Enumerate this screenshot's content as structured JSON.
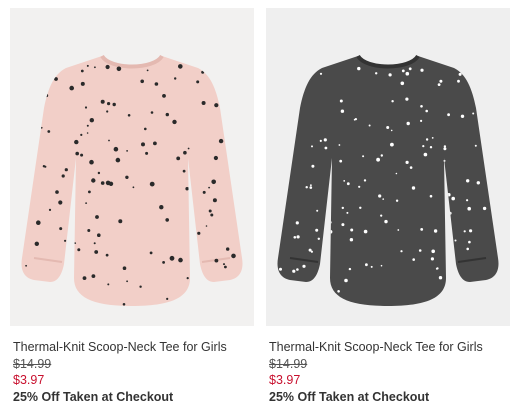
{
  "products": [
    {
      "title": "Thermal-Knit Scoop-Neck Tee for Girls",
      "original_price": "$14.99",
      "sale_price": "$3.97",
      "promo": "25% Off Taken at Checkout",
      "shirt_color": "#f2cfc8",
      "dot_color": "#2a2a2a",
      "image_icon": "pink-polka-dot-tee-image"
    },
    {
      "title": "Thermal-Knit Scoop-Neck Tee for Girls",
      "original_price": "$14.99",
      "sale_price": "$3.97",
      "promo": "25% Off Taken at Checkout",
      "shirt_color": "#4a4a4a",
      "dot_color": "#ffffff",
      "image_icon": "charcoal-polka-dot-tee-image"
    }
  ],
  "colors": {
    "sale_price": "#c8102e",
    "text": "#333333"
  }
}
